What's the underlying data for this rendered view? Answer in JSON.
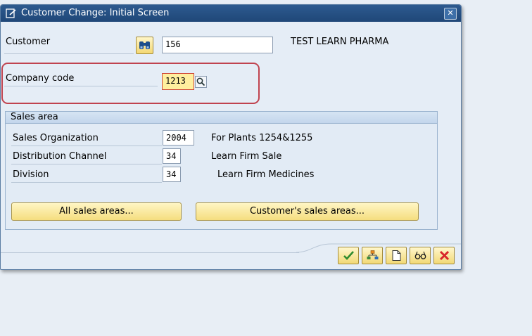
{
  "dialog": {
    "title": "Customer Change: Initial Screen",
    "title_icon": "change-document-icon",
    "close_icon": "close-icon"
  },
  "customer": {
    "label": "Customer",
    "value": "156",
    "description": "TEST LEARN PHARMA",
    "search_icon": "binoculars-icon"
  },
  "company_code": {
    "label": "Company code",
    "value": "1213",
    "f4_icon": "magnifier-icon"
  },
  "sales_area": {
    "title": "Sales area",
    "rows": [
      {
        "label": "Sales Organization",
        "value": "2004",
        "description": "For Plants 1254&1255"
      },
      {
        "label": "Distribution Channel",
        "value": "34",
        "description": "Learn Firm Sale"
      },
      {
        "label": "Division",
        "value": "34",
        "description": "Learn Firm Medicines"
      }
    ],
    "buttons": {
      "all_sales_areas": "All sales areas...",
      "customers_sales_areas": "Customer's sales areas..."
    }
  },
  "footer_toolbar": {
    "icons": [
      "checkmark-icon",
      "hierarchy-icon",
      "new-document-icon",
      "glasses-display-icon",
      "cancel-icon"
    ],
    "accent": "#d8262b"
  },
  "colors": {
    "titlebar": "#2d5a8f",
    "dialog_bg": "#e5edf6",
    "highlight_outline": "#c0434f",
    "button_yellow": "#f5de7f"
  }
}
